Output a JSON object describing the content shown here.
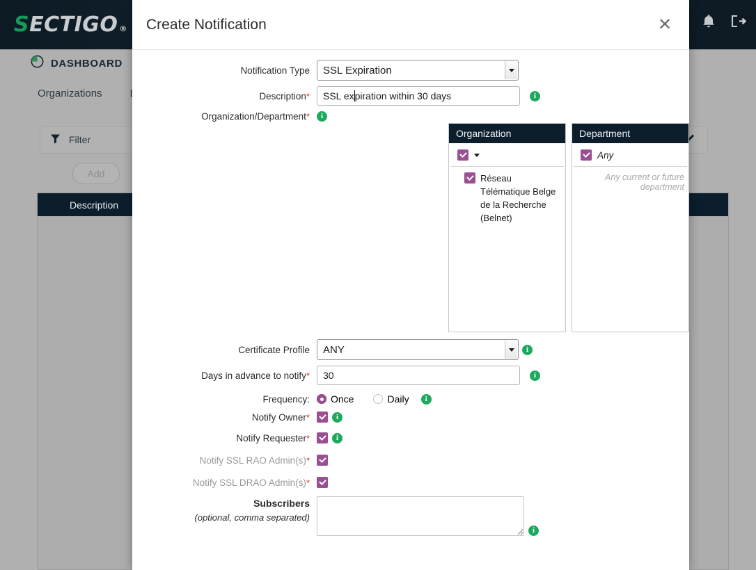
{
  "app": {
    "logo_s": "S",
    "logo_rest": "ECTIGO",
    "logo_reg": "®",
    "dashboard_label": "DASHBOARD",
    "tabs": [
      "Organizations",
      "Dom"
    ],
    "filter_placeholder": "Filter",
    "add_label": "Add",
    "table_header": "Description",
    "icons": {
      "dashboard": "pie-chart-icon",
      "chat": "chat-bubbles-icon",
      "bell": "bell-icon",
      "logout": "logout-icon",
      "filter": "funnel-icon",
      "chevron": "chevron-down-icon"
    }
  },
  "modal": {
    "title": "Create Notification",
    "close_label": "✕",
    "fields": {
      "notification_type": {
        "label": "Notification Type",
        "value": "SSL Expiration",
        "options": [
          "SSL Expiration"
        ]
      },
      "description": {
        "label": "Description",
        "required": "*",
        "value_before_caret": "SSL ex",
        "value_after_caret": "piration within 30 days",
        "full_value": "SSL expiration within 30 days"
      },
      "organization_department": {
        "label": "Organization/Department",
        "required": "*"
      },
      "certificate_profile": {
        "label": "Certificate Profile",
        "value": "ANY",
        "options": [
          "ANY"
        ]
      },
      "days_in_advance": {
        "label": "Days in advance to notify",
        "required": "*",
        "value": "30"
      },
      "frequency": {
        "label": "Frequency:",
        "options": [
          "Once",
          "Daily"
        ],
        "selected": "Once"
      },
      "notify_owner": {
        "label": "Notify Owner",
        "required": "*",
        "checked": true
      },
      "notify_requester": {
        "label": "Notify Requester",
        "required": "*",
        "checked": true
      },
      "notify_ssl_rao": {
        "label": "Notify SSL RAO Admin(s)",
        "required": "*",
        "checked": true
      },
      "notify_ssl_drao": {
        "label": "Notify SSL DRAO Admin(s)",
        "required": "*",
        "checked": true
      },
      "subscribers": {
        "label": "Subscribers",
        "sublabel": "(optional, comma separated)",
        "value": ""
      }
    },
    "organization_panel": {
      "header": "Organization",
      "root_checked": true,
      "children": [
        {
          "label": "Réseau Télématique Belge de la Recherche (Belnet)",
          "checked": true
        }
      ]
    },
    "department_panel": {
      "header": "Department",
      "any_label": "Any",
      "any_checked": true,
      "note": "Any current or future department"
    },
    "info_icon_char": "i"
  },
  "colors": {
    "header_dark": "#0c1e2c",
    "accent_purple": "#9a4f92",
    "info_green": "#1eaa5e",
    "required_red": "#e03030",
    "logo_green": "#159b5a"
  }
}
